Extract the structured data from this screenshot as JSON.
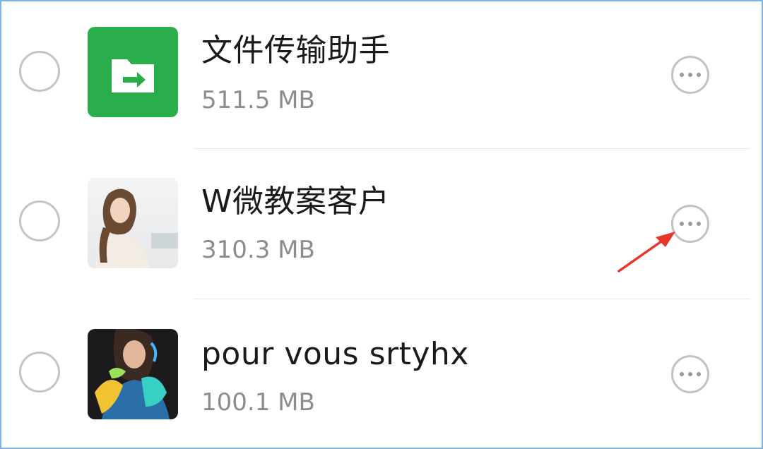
{
  "items": [
    {
      "name": "文件传输助手",
      "size": "511.5 MB",
      "avatar_icon": "file-transfer-folder-icon",
      "avatar_color": "#2aae4c"
    },
    {
      "name": "W微教案客户",
      "size": "310.3 MB",
      "avatar_icon": "user-photo-avatar"
    },
    {
      "name": "pour vous srtyhx",
      "size": "100.1 MB",
      "avatar_icon": "user-photo-avatar"
    }
  ],
  "annotation": {
    "arrow_color": "#e8352c",
    "points_to": "more-options-button of item 2"
  },
  "colors": {
    "frame_border": "#7fb3e6",
    "radio_border": "#c4c4c4",
    "more_border": "#c2c2c2",
    "size_text": "#8c8c8c"
  }
}
